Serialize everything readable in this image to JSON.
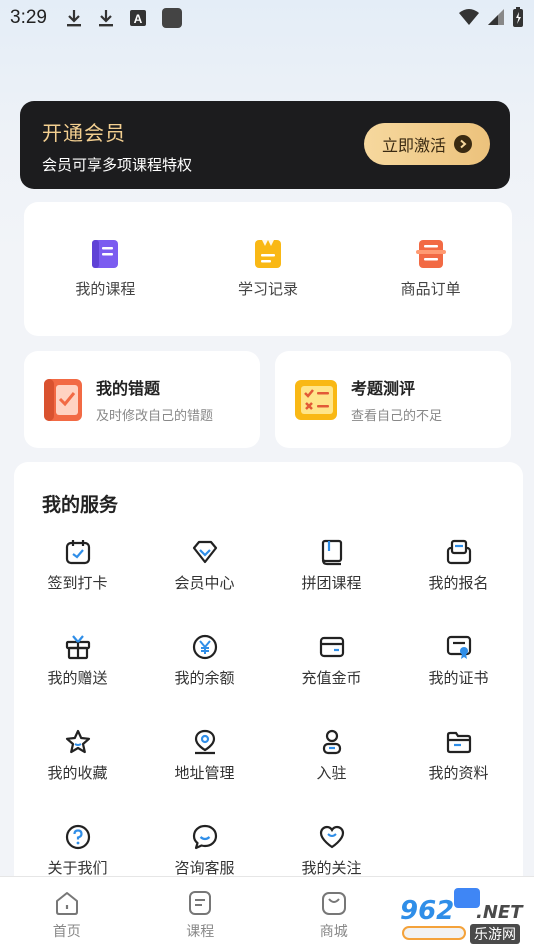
{
  "status_bar": {
    "time": "3:29",
    "icons": [
      "download-icon",
      "download-icon",
      "font-icon",
      "app-square-icon"
    ],
    "right_icons": [
      "wifi-icon",
      "signal-icon",
      "battery-charging-icon"
    ]
  },
  "vip": {
    "title": "开通会员",
    "subtitle": "会员可享多项课程特权",
    "button": "立即激活"
  },
  "quick": [
    {
      "label": "我的课程",
      "icon": "course-book-icon",
      "color": "#7b5cf0"
    },
    {
      "label": "学习记录",
      "icon": "study-record-icon",
      "color": "#f9b815"
    },
    {
      "label": "商品订单",
      "icon": "order-icon",
      "color": "#f26a44"
    }
  ],
  "cards": [
    {
      "title": "我的错题",
      "subtitle": "及时修改自己的错题",
      "icon": "wrong-questions-icon",
      "color": "#f26a44"
    },
    {
      "title": "考题测评",
      "subtitle": "查看自己的不足",
      "icon": "exam-review-icon",
      "color": "#f9b815"
    }
  ],
  "services": {
    "title": "我的服务",
    "items": [
      {
        "label": "签到打卡",
        "icon": "calendar-check-icon"
      },
      {
        "label": "会员中心",
        "icon": "diamond-icon"
      },
      {
        "label": "拼团课程",
        "icon": "book-icon"
      },
      {
        "label": "我的报名",
        "icon": "signup-icon"
      },
      {
        "label": "我的赠送",
        "icon": "gift-icon"
      },
      {
        "label": "我的余额",
        "icon": "yuan-icon"
      },
      {
        "label": "充值金币",
        "icon": "card-icon"
      },
      {
        "label": "我的证书",
        "icon": "certificate-icon"
      },
      {
        "label": "我的收藏",
        "icon": "star-icon"
      },
      {
        "label": "地址管理",
        "icon": "location-icon"
      },
      {
        "label": "入驻",
        "icon": "person-icon"
      },
      {
        "label": "我的资料",
        "icon": "folder-icon"
      },
      {
        "label": "关于我们",
        "icon": "question-icon"
      },
      {
        "label": "咨询客服",
        "icon": "chat-icon"
      },
      {
        "label": "我的关注",
        "icon": "heart-icon"
      }
    ]
  },
  "nav": [
    {
      "label": "首页",
      "icon": "home-icon"
    },
    {
      "label": "课程",
      "icon": "course-icon"
    },
    {
      "label": "商城",
      "icon": "shop-icon"
    },
    {
      "label": "",
      "icon": "profile-icon"
    }
  ],
  "watermark": {
    "number": "962",
    "suffix": ".NET",
    "cn": "乐游网"
  },
  "colors": {
    "accent_dark": "#1c1c1e",
    "gold": "#f3cf90",
    "blue": "#2f8ee8"
  }
}
